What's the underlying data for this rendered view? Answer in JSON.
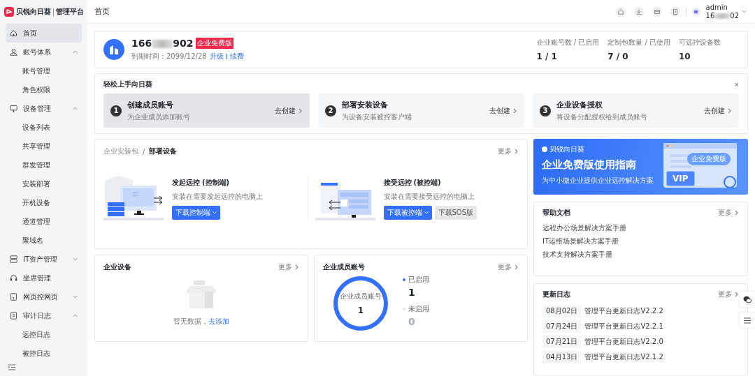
{
  "brand": {
    "name": "贝锐向日葵",
    "subtitle": "管理平台"
  },
  "sidebar": {
    "items": [
      {
        "label": "首页",
        "selected": true
      },
      {
        "label": "账号体系",
        "selected": false,
        "expanded": true,
        "children": [
          {
            "label": "账号管理",
            "selected": false
          },
          {
            "label": "角色权限",
            "selected": false
          }
        ]
      },
      {
        "label": "设备管理",
        "selected": false,
        "expanded": true,
        "children": [
          {
            "label": "设备列表",
            "selected": false
          },
          {
            "label": "共享管理",
            "selected": false
          },
          {
            "label": "群发管理",
            "selected": false
          },
          {
            "label": "安装部署",
            "selected": false
          },
          {
            "label": "开机设备",
            "selected": false
          },
          {
            "label": "通道管理",
            "selected": false
          },
          {
            "label": "聚域名",
            "selected": false
          }
        ]
      },
      {
        "label": "IT资产管理",
        "selected": false,
        "expanded": false
      },
      {
        "label": "坐席管理",
        "selected": false
      },
      {
        "label": "网页控网页",
        "selected": false,
        "expanded": false
      },
      {
        "label": "审计日志",
        "selected": false,
        "expanded": true,
        "children": [
          {
            "label": "远控日志",
            "selected": false
          },
          {
            "label": "被控日志",
            "selected": false
          }
        ]
      }
    ]
  },
  "header": {
    "title": "首页",
    "user": {
      "name": "admin",
      "id_prefix": "16",
      "id_suffix": "02"
    }
  },
  "account": {
    "id_prefix": "166",
    "id_suffix": "902",
    "badge": "企业免费版",
    "expiry": "到期时间：2099/12/28",
    "links": [
      "升级",
      "续费"
    ],
    "stats": [
      {
        "label": "企业账号数 / 已启用",
        "value": "1 / 1"
      },
      {
        "label": "定制包数量 / 已使用",
        "value": "7 / 0"
      },
      {
        "label": "可远控设备数",
        "value": "10"
      }
    ]
  },
  "quickstart": {
    "title": "轻松上手向日葵",
    "close": "×",
    "steps": [
      {
        "number": "1",
        "title": "创建成员账号",
        "desc": "为企业成员添加账号",
        "action": "去创建",
        "selected": true
      },
      {
        "number": "2",
        "title": "部署安装设备",
        "desc": "为设备安装被控客户端",
        "action": "去创建",
        "selected": false
      },
      {
        "number": "3",
        "title": "企业设备授权",
        "desc": "将设备分配授权给到成员账号",
        "action": "去创建",
        "selected": false
      }
    ]
  },
  "deploy": {
    "breadcrumb": "企业安装包",
    "separator": "/",
    "title": "部署设备",
    "more": "更多",
    "panels": [
      {
        "title": "发起远控",
        "role": "(控制端)",
        "desc": "安装在需要发起远控的电脑上",
        "buttons": [
          {
            "label": "下载控制端",
            "kind": "primary"
          }
        ]
      },
      {
        "title": "接受远控",
        "role": "(被控端)",
        "desc": "安装在需要接受远控的电脑上",
        "buttons": [
          {
            "label": "下载被控端",
            "kind": "primary"
          },
          {
            "label": "下载SOS版",
            "kind": "secondary"
          }
        ]
      }
    ]
  },
  "devices": {
    "title": "企业设备",
    "more": "更多",
    "empty_text": "暂无数据，",
    "add_link": "去添加"
  },
  "members": {
    "title": "企业成员账号",
    "more": "更多",
    "ring_label": "企业成员账号",
    "ring_value": "1",
    "level": 1,
    "legend": [
      {
        "label": "已启用",
        "value": "1",
        "color": "#3370ff"
      },
      {
        "label": "未启用",
        "value": "0",
        "color": "#e5e6eb"
      }
    ]
  },
  "banner": {
    "brand": "贝锐向日葵",
    "title": "企业免费版使用指南",
    "subtitle": "为中小微企业提供企业远控解决方案",
    "badge": "企业免费版",
    "vip": "VIP"
  },
  "help": {
    "title": "帮助文档",
    "more": "更多",
    "links": [
      "远程办公场景解决方案手册",
      "IT运维场景解决方案手册",
      "技术支持解决方案手册"
    ]
  },
  "changelog": {
    "title": "更新日志",
    "more": "更多",
    "entries": [
      {
        "date": "08月02日",
        "title": "管理平台更新日志V2.2.2"
      },
      {
        "date": "07月24日",
        "title": "管理平台更新日志V2.2.1"
      },
      {
        "date": "07月21日",
        "title": "管理平台更新日志V2.2.0"
      },
      {
        "date": "04月13日",
        "title": "管理平台更新日志V2.1.2"
      }
    ]
  }
}
